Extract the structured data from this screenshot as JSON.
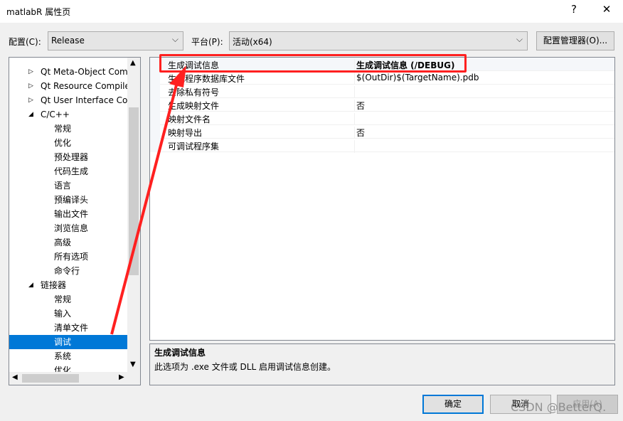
{
  "window": {
    "title": "matlabR 属性页",
    "help": "?",
    "close": "✕"
  },
  "toolbar": {
    "config_label": "配置(C):",
    "config_value": "Release",
    "platform_label": "平台(P):",
    "platform_value": "活动(x64)",
    "config_manager": "配置管理器(O)..."
  },
  "tree": {
    "items": [
      {
        "label": "Qt Meta-Object Com",
        "level": 1,
        "expander": "collapsed"
      },
      {
        "label": "Qt Resource Compile",
        "level": 1,
        "expander": "collapsed"
      },
      {
        "label": "Qt User Interface Co",
        "level": 1,
        "expander": "collapsed"
      },
      {
        "label": "C/C++",
        "level": 1,
        "expander": "expanded"
      },
      {
        "label": "常规",
        "level": 2
      },
      {
        "label": "优化",
        "level": 2
      },
      {
        "label": "预处理器",
        "level": 2
      },
      {
        "label": "代码生成",
        "level": 2
      },
      {
        "label": "语言",
        "level": 2
      },
      {
        "label": "预编译头",
        "level": 2
      },
      {
        "label": "输出文件",
        "level": 2
      },
      {
        "label": "浏览信息",
        "level": 2
      },
      {
        "label": "高级",
        "level": 2
      },
      {
        "label": "所有选项",
        "level": 2
      },
      {
        "label": "命令行",
        "level": 2
      },
      {
        "label": "链接器",
        "level": 1,
        "expander": "expanded"
      },
      {
        "label": "常规",
        "level": 2
      },
      {
        "label": "输入",
        "level": 2
      },
      {
        "label": "清单文件",
        "level": 2
      },
      {
        "label": "调试",
        "level": 2,
        "selected": true
      },
      {
        "label": "系统",
        "level": 2
      },
      {
        "label": "优化",
        "level": 2
      }
    ]
  },
  "properties": [
    {
      "name": "生成调试信息",
      "value": "生成调试信息 (/DEBUG)",
      "bold": true
    },
    {
      "name": "生成程序数据库文件",
      "value": "$(OutDir)$(TargetName).pdb"
    },
    {
      "name": "去除私有符号",
      "value": ""
    },
    {
      "name": "生成映射文件",
      "value": "否"
    },
    {
      "name": "映射文件名",
      "value": ""
    },
    {
      "name": "映射导出",
      "value": "否"
    },
    {
      "name": "可调试程序集",
      "value": ""
    }
  ],
  "description": {
    "title": "生成调试信息",
    "text": "此选项为 .exe 文件或 DLL 启用调试信息创建。"
  },
  "buttons": {
    "ok": "确定",
    "cancel": "取消",
    "apply": "应用(A)"
  },
  "watermark": "CSDN @BetterQ.",
  "colors": {
    "selection": "#0078d7",
    "annotation": "#ff2020"
  }
}
